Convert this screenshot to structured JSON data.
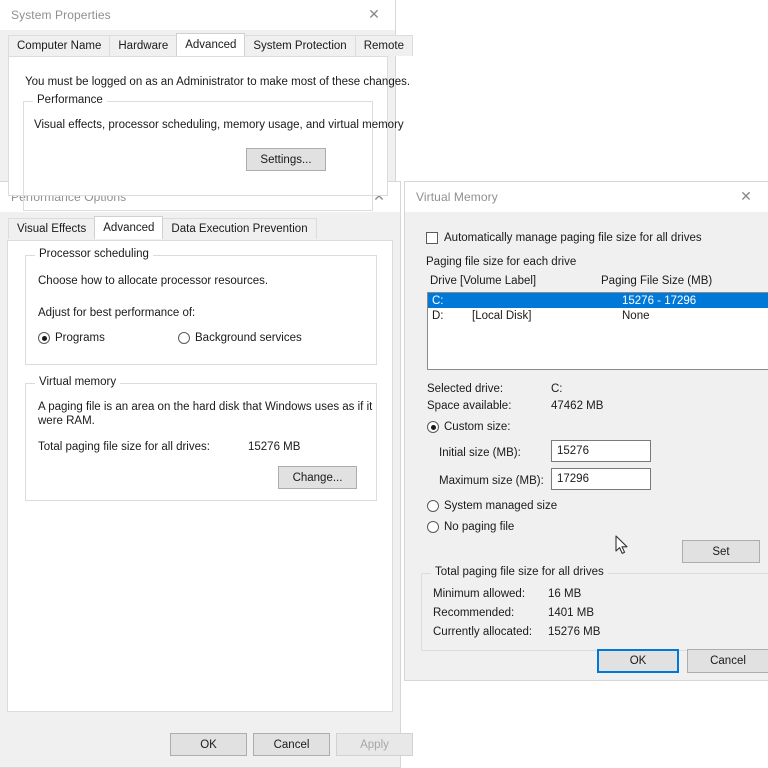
{
  "system_properties": {
    "title": "System Properties",
    "close_icon": "close-icon",
    "tabs": [
      {
        "label": "Computer Name",
        "active": false
      },
      {
        "label": "Hardware",
        "active": false
      },
      {
        "label": "Advanced",
        "active": true
      },
      {
        "label": "System Protection",
        "active": false
      },
      {
        "label": "Remote",
        "active": false
      }
    ],
    "admin_notice": "You must be logged on as an Administrator to make most of these changes.",
    "performance_group": {
      "legend": "Performance",
      "description": "Visual effects, processor scheduling, memory usage, and virtual memory",
      "settings_button": "Settings..."
    }
  },
  "performance_options": {
    "title": "Performance Options",
    "close_icon": "close-icon",
    "tabs": [
      {
        "label": "Visual Effects",
        "active": false
      },
      {
        "label": "Advanced",
        "active": true
      },
      {
        "label": "Data Execution Prevention",
        "active": false
      }
    ],
    "processor_scheduling": {
      "legend": "Processor scheduling",
      "description": "Choose how to allocate processor resources.",
      "adjust_label": "Adjust for best performance of:",
      "options": [
        {
          "label": "Programs",
          "checked": true
        },
        {
          "label": "Background services",
          "checked": false
        }
      ]
    },
    "virtual_memory": {
      "legend": "Virtual memory",
      "description_line1": "A paging file is an area on the hard disk that Windows uses as if it",
      "description_line2": "were RAM.",
      "total_label": "Total paging file size for all drives:",
      "total_value": "15276 MB",
      "change_button": "Change..."
    },
    "footer_buttons": [
      {
        "label": "OK",
        "state": "normal"
      },
      {
        "label": "Cancel",
        "state": "normal"
      },
      {
        "label": "Apply",
        "state": "disabled"
      }
    ]
  },
  "virtual_memory_dialog": {
    "title": "Virtual Memory",
    "close_icon": "close-icon",
    "auto_manage": {
      "label": "Automatically manage paging file size for all drives",
      "checked": false
    },
    "paging_section_label": "Paging file size for each drive",
    "columns": {
      "drive": "Drive  [Volume Label]",
      "size": "Paging File Size (MB)"
    },
    "drives": [
      {
        "drive": "C:",
        "volume_label": "",
        "size": "15276 - 17296",
        "selected": true
      },
      {
        "drive": "D:",
        "volume_label": "[Local Disk]",
        "size": "None",
        "selected": false
      }
    ],
    "selected_drive_label": "Selected drive:",
    "selected_drive_value": "C:",
    "space_available_label": "Space available:",
    "space_available_value": "47462 MB",
    "size_options": [
      {
        "label": "Custom size:",
        "checked": true
      },
      {
        "label": "System managed size",
        "checked": false
      },
      {
        "label": "No paging file",
        "checked": false
      }
    ],
    "initial_size_label": "Initial size (MB):",
    "initial_size_value": "15276",
    "maximum_size_label": "Maximum size (MB):",
    "maximum_size_value": "17296",
    "set_button": "Set",
    "totals": {
      "legend": "Total paging file size for all drives",
      "rows": [
        {
          "label": "Minimum allowed:",
          "value": "16 MB"
        },
        {
          "label": "Recommended:",
          "value": "1401 MB"
        },
        {
          "label": "Currently allocated:",
          "value": "15276 MB"
        }
      ]
    },
    "footer_buttons": [
      {
        "label": "OK",
        "state": "default"
      },
      {
        "label": "Cancel",
        "state": "normal"
      }
    ]
  },
  "colors": {
    "selection_blue": "#0078d7",
    "window_bg": "#f0f0f0",
    "panel_bg": "#ffffff",
    "text": "#1a1a1a",
    "disabled_text": "#a6a6a6",
    "title_text": "#909090"
  }
}
